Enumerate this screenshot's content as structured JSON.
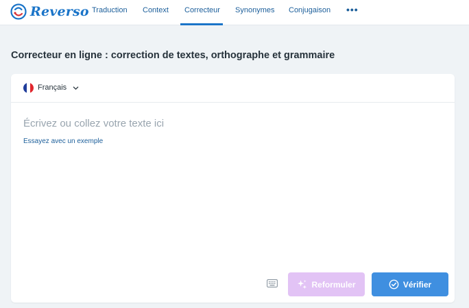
{
  "brand": {
    "name": "Reverso",
    "color": "#1a74c8"
  },
  "nav": {
    "items": [
      {
        "label": "Traduction"
      },
      {
        "label": "Context"
      },
      {
        "label": "Correcteur",
        "active": true
      },
      {
        "label": "Synonymes"
      },
      {
        "label": "Conjugaison"
      }
    ],
    "more_icon": "more-horizontal-icon",
    "more_label": "•••"
  },
  "page": {
    "title_bold": "Correcteur en ligne :",
    "title_rest": " correction de textes, orthographe et grammaire"
  },
  "editor": {
    "language": "Français",
    "language_icon": "flag-fr-icon",
    "placeholder": "Écrivez ou collez votre texte ici",
    "example_link": "Essayez avec un exemple",
    "keyboard_icon": "keyboard-icon"
  },
  "actions": {
    "reformulate_label": "Reformuler",
    "reformulate_icon": "sparkle-icon",
    "reformulate_color": "#e2c3f5",
    "verify_label": "Vérifier",
    "verify_icon": "check-circle-icon",
    "verify_color": "#3f8fe0"
  }
}
